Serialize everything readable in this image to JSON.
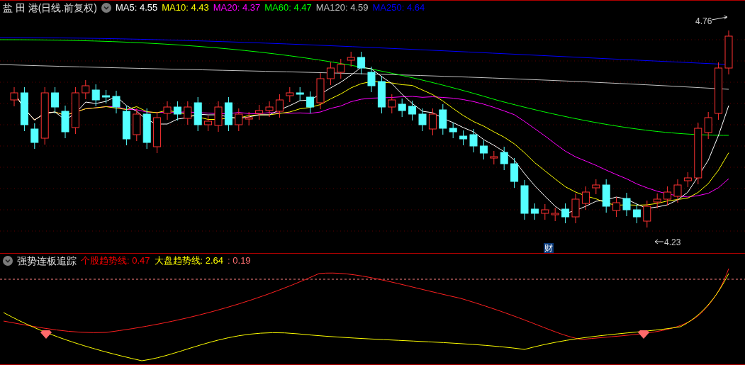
{
  "price_panel": {
    "title": "盐 田 港(日线.前复权)",
    "ma_legend": [
      {
        "text": "MA5: 4.55",
        "color": "#ffffff"
      },
      {
        "text": "MA10: 4.43",
        "color": "#ffff00"
      },
      {
        "text": "MA20: 4.37",
        "color": "#ff00ff"
      },
      {
        "text": "MA60: 4.47",
        "color": "#00ff00"
      },
      {
        "text": "MA120: 4.59",
        "color": "#c0c0c0"
      },
      {
        "text": "MA250: 4.64",
        "color": "#0000ff"
      }
    ],
    "high_label": "4.76",
    "low_label": "4.23",
    "event_badge": "财"
  },
  "indicator_panel": {
    "title": "强势连板追踪",
    "legend": [
      {
        "text": "个股趋势线: 0.47",
        "color": "#ff0000"
      },
      {
        "text": "大盘趋势线: 2.64",
        "color": "#ffff00"
      },
      {
        "text": ": 0.19",
        "color": "#ff7070"
      }
    ]
  }
}
